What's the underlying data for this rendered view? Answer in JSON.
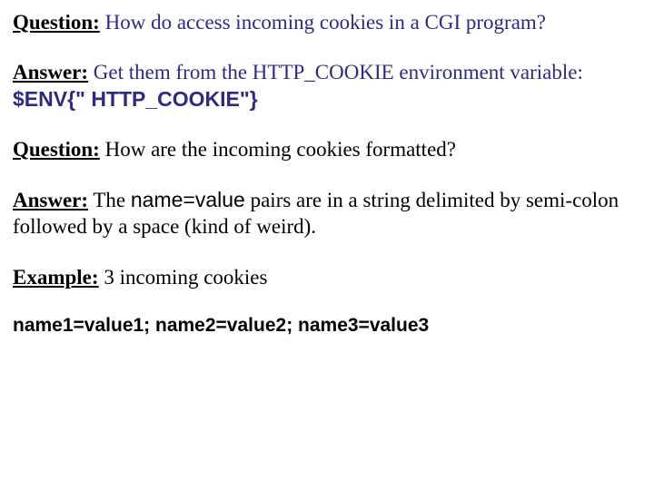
{
  "q1": {
    "label": "Question:",
    "text": " How do access incoming cookies in a CGI program?"
  },
  "a1": {
    "label": "Answer:",
    "text_before": " Get them from the HTTP_COOKIE environment variable:  ",
    "code": "$ENV{\" HTTP_COOKIE\"}"
  },
  "q2": {
    "label": "Question:",
    "text": " How are the incoming cookies formatted?"
  },
  "a2": {
    "label": "Answer:",
    "text_before": " The ",
    "code": "name=value",
    "text_after": " pairs are in a string delimited by semi-colon followed by a space (kind of weird)."
  },
  "ex": {
    "label": "Example:",
    "text": "  3 incoming cookies"
  },
  "code_line": "name1=value1; name2=value2; name3=value3"
}
